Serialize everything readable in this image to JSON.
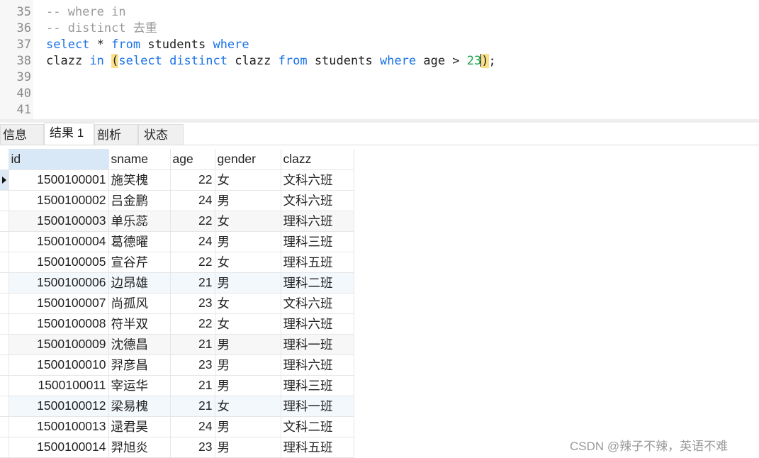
{
  "editor": {
    "lines": [
      {
        "num": "35",
        "tokens": [
          {
            "t": "-- where in",
            "c": "cm"
          }
        ]
      },
      {
        "num": "36",
        "tokens": [
          {
            "t": "-- distinct 去重",
            "c": "cm"
          }
        ]
      },
      {
        "num": "37",
        "tokens": [
          {
            "t": "select",
            "c": "kw"
          },
          {
            "t": " * ",
            "c": ""
          },
          {
            "t": "from",
            "c": "kw"
          },
          {
            "t": " students ",
            "c": ""
          },
          {
            "t": "where",
            "c": "kw"
          }
        ]
      },
      {
        "num": "38",
        "tokens": [
          {
            "t": "clazz ",
            "c": ""
          },
          {
            "t": "in",
            "c": "kw"
          },
          {
            "t": " ",
            "c": ""
          },
          {
            "t": "(",
            "c": "hl"
          },
          {
            "t": "select",
            "c": "kw"
          },
          {
            "t": " ",
            "c": ""
          },
          {
            "t": "distinct",
            "c": "kw"
          },
          {
            "t": " clazz ",
            "c": ""
          },
          {
            "t": "from",
            "c": "kw"
          },
          {
            "t": " students ",
            "c": ""
          },
          {
            "t": "where",
            "c": "kw"
          },
          {
            "t": " age > ",
            "c": ""
          },
          {
            "t": "23",
            "c": "num"
          },
          {
            "t": "CARET",
            "c": "caret"
          },
          {
            "t": ")",
            "c": "hl"
          },
          {
            "t": ";",
            "c": ""
          }
        ]
      },
      {
        "num": "39",
        "tokens": []
      },
      {
        "num": "40",
        "tokens": []
      },
      {
        "num": "41",
        "tokens": []
      }
    ]
  },
  "tabs": [
    {
      "label": "信息",
      "active": false
    },
    {
      "label": "结果 1",
      "active": true
    },
    {
      "label": "剖析",
      "active": false
    },
    {
      "label": "状态",
      "active": false
    }
  ],
  "results": {
    "columns": [
      "id",
      "sname",
      "age",
      "gender",
      "clazz"
    ],
    "rows": [
      [
        "1500100001",
        "施笑槐",
        "22",
        "女",
        "文科六班"
      ],
      [
        "1500100002",
        "吕金鹏",
        "24",
        "男",
        "文科六班"
      ],
      [
        "1500100003",
        "单乐蕊",
        "22",
        "女",
        "理科六班"
      ],
      [
        "1500100004",
        "葛德曜",
        "24",
        "男",
        "理科三班"
      ],
      [
        "1500100005",
        "宣谷芹",
        "22",
        "女",
        "理科五班"
      ],
      [
        "1500100006",
        "边昂雄",
        "21",
        "男",
        "理科二班"
      ],
      [
        "1500100007",
        "尚孤风",
        "23",
        "女",
        "文科六班"
      ],
      [
        "1500100008",
        "符半双",
        "22",
        "女",
        "理科六班"
      ],
      [
        "1500100009",
        "沈德昌",
        "21",
        "男",
        "理科一班"
      ],
      [
        "1500100010",
        "羿彦昌",
        "23",
        "男",
        "理科六班"
      ],
      [
        "1500100011",
        "宰运华",
        "21",
        "男",
        "理科三班"
      ],
      [
        "1500100012",
        "梁易槐",
        "21",
        "女",
        "理科一班"
      ],
      [
        "1500100013",
        "逯君昊",
        "24",
        "男",
        "文科二班"
      ],
      [
        "1500100014",
        "羿旭炎",
        "23",
        "男",
        "理科五班"
      ]
    ]
  },
  "watermark": "CSDN @辣子不辣，英语不难"
}
